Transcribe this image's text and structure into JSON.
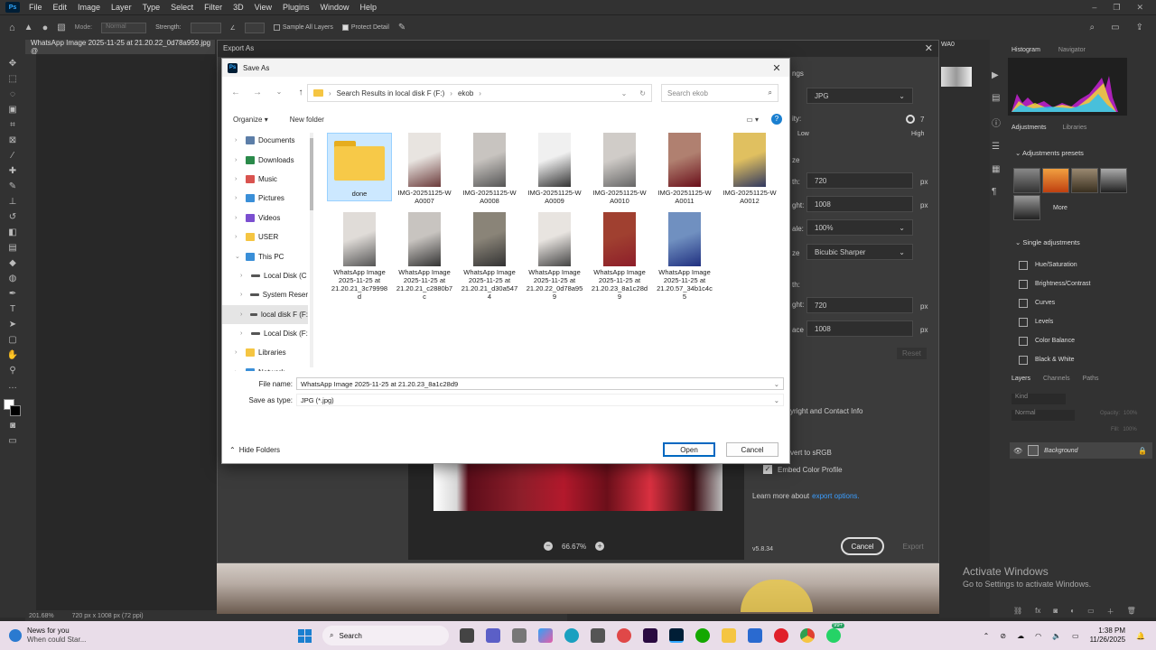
{
  "photoshop": {
    "logo": "Ps",
    "menu": [
      "File",
      "Edit",
      "Image",
      "Layer",
      "Type",
      "Select",
      "Filter",
      "3D",
      "View",
      "Plugins",
      "Window",
      "Help"
    ],
    "options": {
      "mode_label": "Mode:",
      "mode_value": "Normal",
      "strength_label": "Strength:",
      "sample_all_layers": "Sample All Layers",
      "protect_detail": "Protect Detail"
    },
    "document_tab": "WhatsApp Image 2025-11-25 at 21.20.22_0d78a959.jpg @",
    "status_zoom": "201.68%",
    "status_size": "720 px x 1008 px (72 ppi)"
  },
  "right_panels": {
    "top_tabs": [
      "Histogram",
      "Navigator"
    ],
    "adj_tabs": [
      "Adjustments",
      "Libraries"
    ],
    "adjustments_presets": "Adjustments presets",
    "more_label": "More",
    "single_adjustments": "Single adjustments",
    "adjustments": [
      "Hue/Saturation",
      "Brightness/Contrast",
      "Curves",
      "Levels",
      "Color Balance",
      "Black & White"
    ],
    "layer_tabs": [
      "Layers",
      "Channels",
      "Paths"
    ],
    "kind_placeholder": "Kind",
    "blend_mode": "Normal",
    "opacity_label": "Opacity:",
    "opacity_value": "100%",
    "fill_label": "Fill:",
    "fill_value": "100%",
    "layer_name": "Background",
    "wa_label": "WA0"
  },
  "export_as": {
    "title": "Export As",
    "format_label": "JPG",
    "quality_number": "7",
    "low": "Low",
    "high": "High",
    "width1": "720",
    "height1": "1008",
    "scale": "100%",
    "resample": "Bicubic Sharper",
    "width2": "720",
    "height2": "1008",
    "px": "px",
    "reset": "Reset",
    "metadata": "yright and Contact Info",
    "convert_srgb": "vert to sRGB",
    "embed_color_profile": "Embed Color Profile",
    "learn_more": "Learn more about",
    "export_options_link": "export options.",
    "version": "v5.8.34",
    "zoom": "66.67%",
    "cancel": "Cancel",
    "export": "Export",
    "partial_labels": [
      "ngs",
      "ity:",
      "ze",
      "th:",
      "ght:",
      "ale:",
      "ze",
      "th:",
      "ght:",
      "ace"
    ]
  },
  "save_as": {
    "title": "Save As",
    "breadcrumb": [
      "Search Results in local disk F (F:)",
      "ekob"
    ],
    "search_placeholder": "Search ekob",
    "organize": "Organize",
    "new_folder": "New folder",
    "nav": [
      {
        "label": "Documents",
        "color": "#5c7ea8"
      },
      {
        "label": "Downloads",
        "color": "#2a8a4a"
      },
      {
        "label": "Music",
        "color": "#d9534f"
      },
      {
        "label": "Pictures",
        "color": "#3a8fd8"
      },
      {
        "label": "Videos",
        "color": "#7b4fd0"
      },
      {
        "label": "USER",
        "color": "#f5c542"
      },
      {
        "label": "This PC",
        "color": "#3a8fd8"
      },
      {
        "label": "Local Disk (C",
        "color": "#666"
      },
      {
        "label": "System Reser",
        "color": "#666"
      },
      {
        "label": "local disk F (F:",
        "color": "#666"
      },
      {
        "label": "Local Disk (F:",
        "color": "#666"
      },
      {
        "label": "Libraries",
        "color": "#f5c542"
      },
      {
        "label": "Network",
        "color": "#3a8fd8"
      }
    ],
    "files": [
      {
        "name": "done",
        "kind": "folder"
      },
      {
        "name": "IMG-20251125-WA0007",
        "line1": "IMG-20251125-W",
        "line2": "A0007",
        "c1": "#e8e4e0",
        "c2": "#6b3a3a"
      },
      {
        "name": "IMG-20251125-WA0008",
        "line1": "IMG-20251125-W",
        "line2": "A0008",
        "c1": "#c8c4c0",
        "c2": "#555"
      },
      {
        "name": "IMG-20251125-WA0009",
        "line1": "IMG-20251125-W",
        "line2": "A0009",
        "c1": "#f0f0f0",
        "c2": "#333"
      },
      {
        "name": "IMG-20251125-WA0010",
        "line1": "IMG-20251125-W",
        "line2": "A0010",
        "c1": "#d0ccc8",
        "c2": "#666"
      },
      {
        "name": "IMG-20251125-WA0011",
        "line1": "IMG-20251125-W",
        "line2": "A0011",
        "c1": "#b08070",
        "c2": "#6a0f1a"
      },
      {
        "name": "IMG-20251125-WA0012",
        "line1": "IMG-20251125-W",
        "line2": "A0012",
        "c1": "#e0c060",
        "c2": "#303860"
      },
      {
        "name": "WhatsApp Image 2025-11-25 at 21.20.21_3c79998d",
        "line1": "WhatsApp Image",
        "line2": "2025-11-25 at",
        "line3": "21.20.21_3c79998",
        "line4": "d",
        "c1": "#e0dcd8",
        "c2": "#555"
      },
      {
        "name": "WhatsApp Image 2025-11-25 at 21.20.21_c2880b7c",
        "line1": "WhatsApp Image",
        "line2": "2025-11-25 at",
        "line3": "21.20.21_c2880b7",
        "line4": "c",
        "c1": "#c8c4c0",
        "c2": "#333"
      },
      {
        "name": "WhatsApp Image 2025-11-25 at 21.20.21_d30a5474",
        "line1": "WhatsApp Image",
        "line2": "2025-11-25 at",
        "line3": "21.20.21_d30a547",
        "line4": "4",
        "c1": "#8a8478",
        "c2": "#333"
      },
      {
        "name": "WhatsApp Image 2025-11-25 at 21.20.22_0d78a959",
        "line1": "WhatsApp Image",
        "line2": "2025-11-25 at",
        "line3": "21.20.22_0d78a95",
        "line4": "9",
        "c1": "#e8e4e0",
        "c2": "#444"
      },
      {
        "name": "WhatsApp Image 2025-11-25 at 21.20.23_8a1c28d9",
        "line1": "WhatsApp Image",
        "line2": "2025-11-25 at",
        "line3": "21.20.23_8a1c28d",
        "line4": "9",
        "c1": "#a04030",
        "c2": "#8d1e2a"
      },
      {
        "name": "WhatsApp Image 2025-11-25 at 21.20.57_34b1c4c5",
        "line1": "WhatsApp Image",
        "line2": "2025-11-25 at",
        "line3": "21.20.57_34b1c4c",
        "line4": "5",
        "c1": "#7090c0",
        "c2": "#203080"
      }
    ],
    "file_name_label": "File name:",
    "file_name_value": "WhatsApp Image 2025-11-25 at 21.20.23_8a1c28d9",
    "save_type_label": "Save as type:",
    "save_type_value": "JPG (*.jpg)",
    "hide_folders": "Hide Folders",
    "open": "Open",
    "cancel": "Cancel"
  },
  "watermark": {
    "line1": "Activate Windows",
    "line2": "Go to Settings to activate Windows."
  },
  "taskbar": {
    "news_title": "News for you",
    "news_sub": "When could Star...",
    "search": "Search",
    "badge": "99+",
    "time": "1:38 PM",
    "date": "11/26/2025"
  }
}
